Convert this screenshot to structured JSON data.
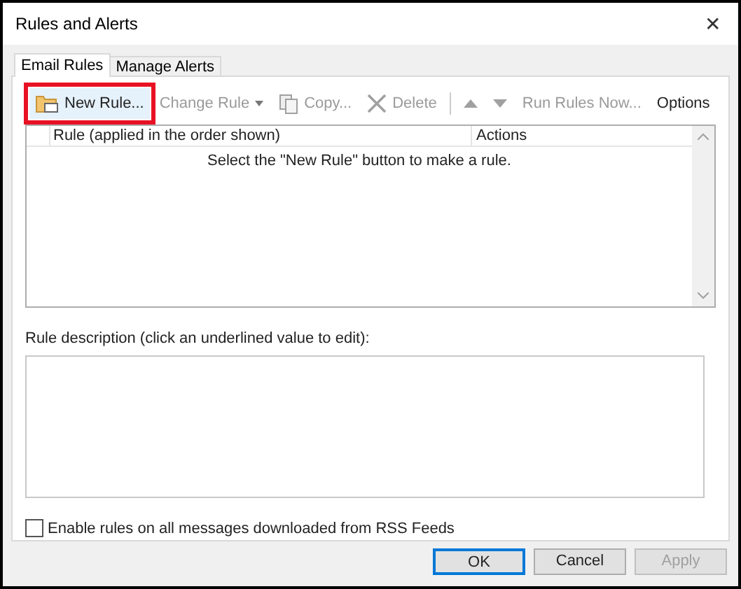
{
  "window": {
    "title": "Rules and Alerts",
    "close": "✕"
  },
  "tabs": [
    {
      "label": "Email Rules",
      "selected": true
    },
    {
      "label": "Manage Alerts",
      "selected": false
    }
  ],
  "toolbar": [
    {
      "kind": "new",
      "label": "New Rule...",
      "disabled": false,
      "highlighted": true
    },
    {
      "kind": "change",
      "label": "Change Rule",
      "disabled": true,
      "highlighted": false
    },
    {
      "kind": "copy",
      "label": "Copy...",
      "disabled": true,
      "highlighted": false
    },
    {
      "kind": "delete",
      "label": "Delete",
      "disabled": true,
      "highlighted": false
    },
    {
      "kind": "up",
      "disabled": true,
      "highlighted": false
    },
    {
      "kind": "down",
      "disabled": true,
      "highlighted": false
    },
    {
      "kind": "text",
      "label": "Run Rules Now...",
      "disabled": true,
      "highlighted": false
    },
    {
      "kind": "text",
      "label": "Options",
      "disabled": false,
      "highlighted": false
    }
  ],
  "table": {
    "columns": [
      "Rule (applied in the order shown)",
      "Actions"
    ],
    "empty_message": "Select the \"New Rule\" button to make a rule."
  },
  "description": {
    "label": "Rule description (click an underlined value to edit):"
  },
  "rss_checkbox": {
    "label": "Enable rules on all messages downloaded from RSS Feeds",
    "checked": false
  },
  "buttons": [
    {
      "label": "OK",
      "default": true,
      "disabled": false
    },
    {
      "label": "Cancel",
      "default": false,
      "disabled": false
    },
    {
      "label": "Apply",
      "default": false,
      "disabled": true
    }
  ]
}
